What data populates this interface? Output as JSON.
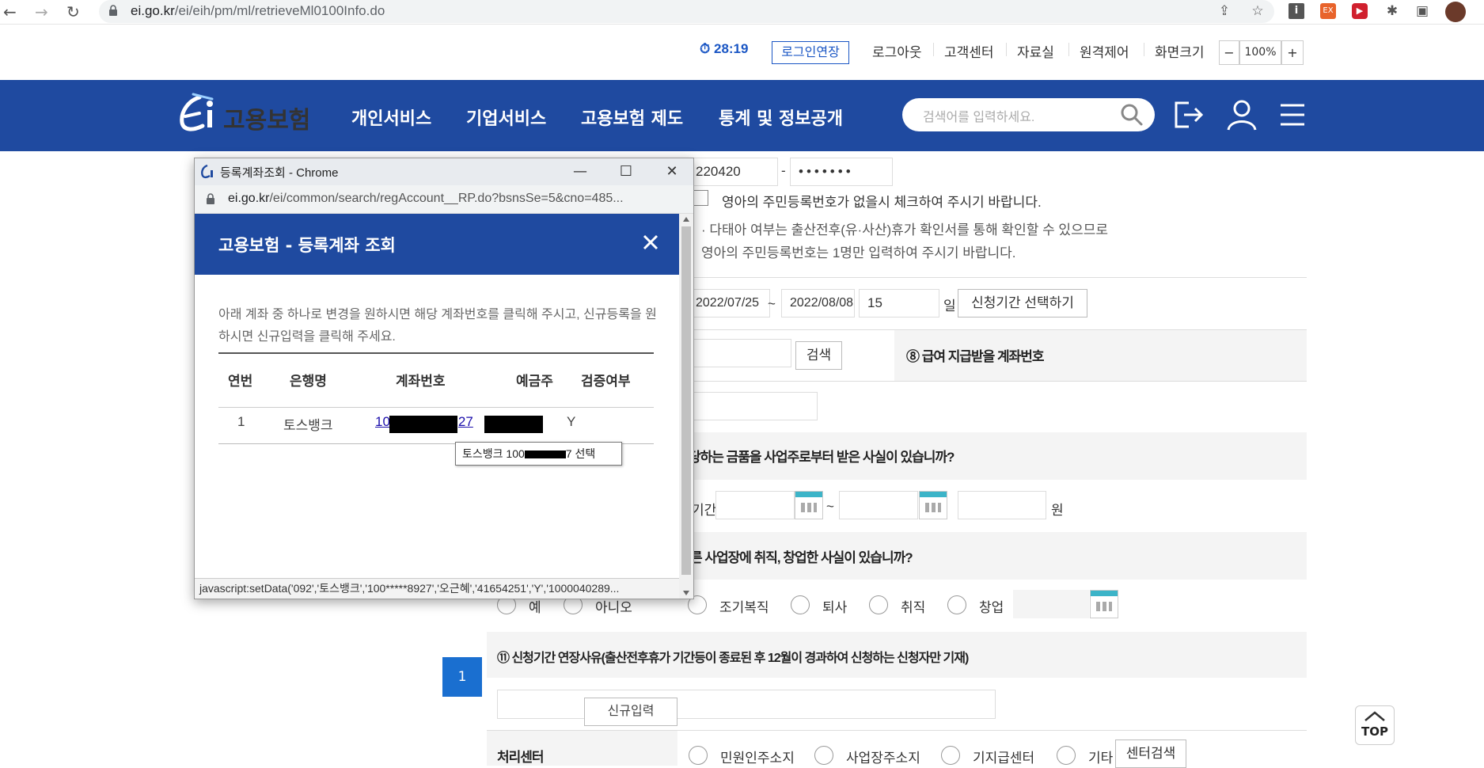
{
  "browser": {
    "url_host": "ei.go.kr",
    "url_path": "/ei/eih/pm/ml/retrieveMl0100Info.do"
  },
  "utility": {
    "timer": "28:19",
    "extend_login": "로그인연장",
    "logout": "로그아웃",
    "customer_center": "고객센터",
    "library": "자료실",
    "remote_control": "원격제어",
    "screen_size": "화면크기",
    "zoom_minus": "−",
    "zoom_value": "100%",
    "zoom_plus": "+"
  },
  "header": {
    "logo_text": "고용보험",
    "nav": [
      "개인서비스",
      "기업서비스",
      "고용보험 제도",
      "통계 및 정보공개"
    ],
    "search_placeholder": "검색어를 입력하세요."
  },
  "form": {
    "id_front": "220420",
    "id_dash": "-",
    "id_back": "•••••••",
    "no_id_check": "영아의 주민등록번호가 없을시 체크하여 주시기 바랍니다.",
    "multi_note_1": "다태아 여부는 출산전후(유·사산)휴가 확인서를 통해 확인할 수 있으므로",
    "multi_note_2": "영아의 주민등록번호는 1명만 입력하여 주시기 바랍니다.",
    "period_start": "2022/07/25",
    "period_tilde": "~",
    "period_end": "2022/08/08",
    "period_days": "15",
    "days_unit": "일",
    "select_period_button": "신청기간 선택하기",
    "search_button": "검색",
    "account_label": "⑧ 급여 지급받을 계좌번호",
    "money_question": "당하는 금품을 사업주로부터 받은 사실이 있습니까?",
    "money_period_label": "기간",
    "money_tilde": "~",
    "money_unit": "원",
    "job_question": "른 사업장에 취직, 창업한 사실이 있습니까?",
    "job_options": [
      "예",
      "아니오",
      "조기복직",
      "퇴사",
      "취직",
      "창업"
    ],
    "extension_label": "⑪ 신청기간 연장사유(출산전후휴가 기간등이 종료된 후 12월이 경과하여 신청하는 신청자만 기재)",
    "center_label": "처리센터",
    "center_options": [
      "민원인주소지",
      "사업장주소지",
      "기지급센터",
      "기타"
    ],
    "center_search_button": "센터검색"
  },
  "popup": {
    "window_title": "등록계좌조회 - Chrome",
    "url_host": "ei.go.kr",
    "url_path": "/ei/common/search/regAccount__RP.do?bsnsSe=5&cno=485...",
    "title": "고용보험 - 등록계좌 조회",
    "description": "아래 계좌 중 하나로 변경을 원하시면 해당 계좌번호를 클릭해 주시고, 신규등록을 원하시면 신규입력을 클릭해 주세요.",
    "columns": [
      "연번",
      "은행명",
      "계좌번호",
      "예금주",
      "검증여부"
    ],
    "row": {
      "no": "1",
      "bank": "토스뱅크",
      "account_start": "10",
      "account_end": "27",
      "verified": "Y"
    },
    "tooltip_prefix": "토스뱅크 100",
    "tooltip_suffix": "7 선택",
    "page": "1",
    "new_button": "신규입력",
    "status_text": "javascript:setData('092','토스뱅크','100*****8927','오근혜','41654251','Y','1000040289..."
  },
  "top_button": "TOP"
}
